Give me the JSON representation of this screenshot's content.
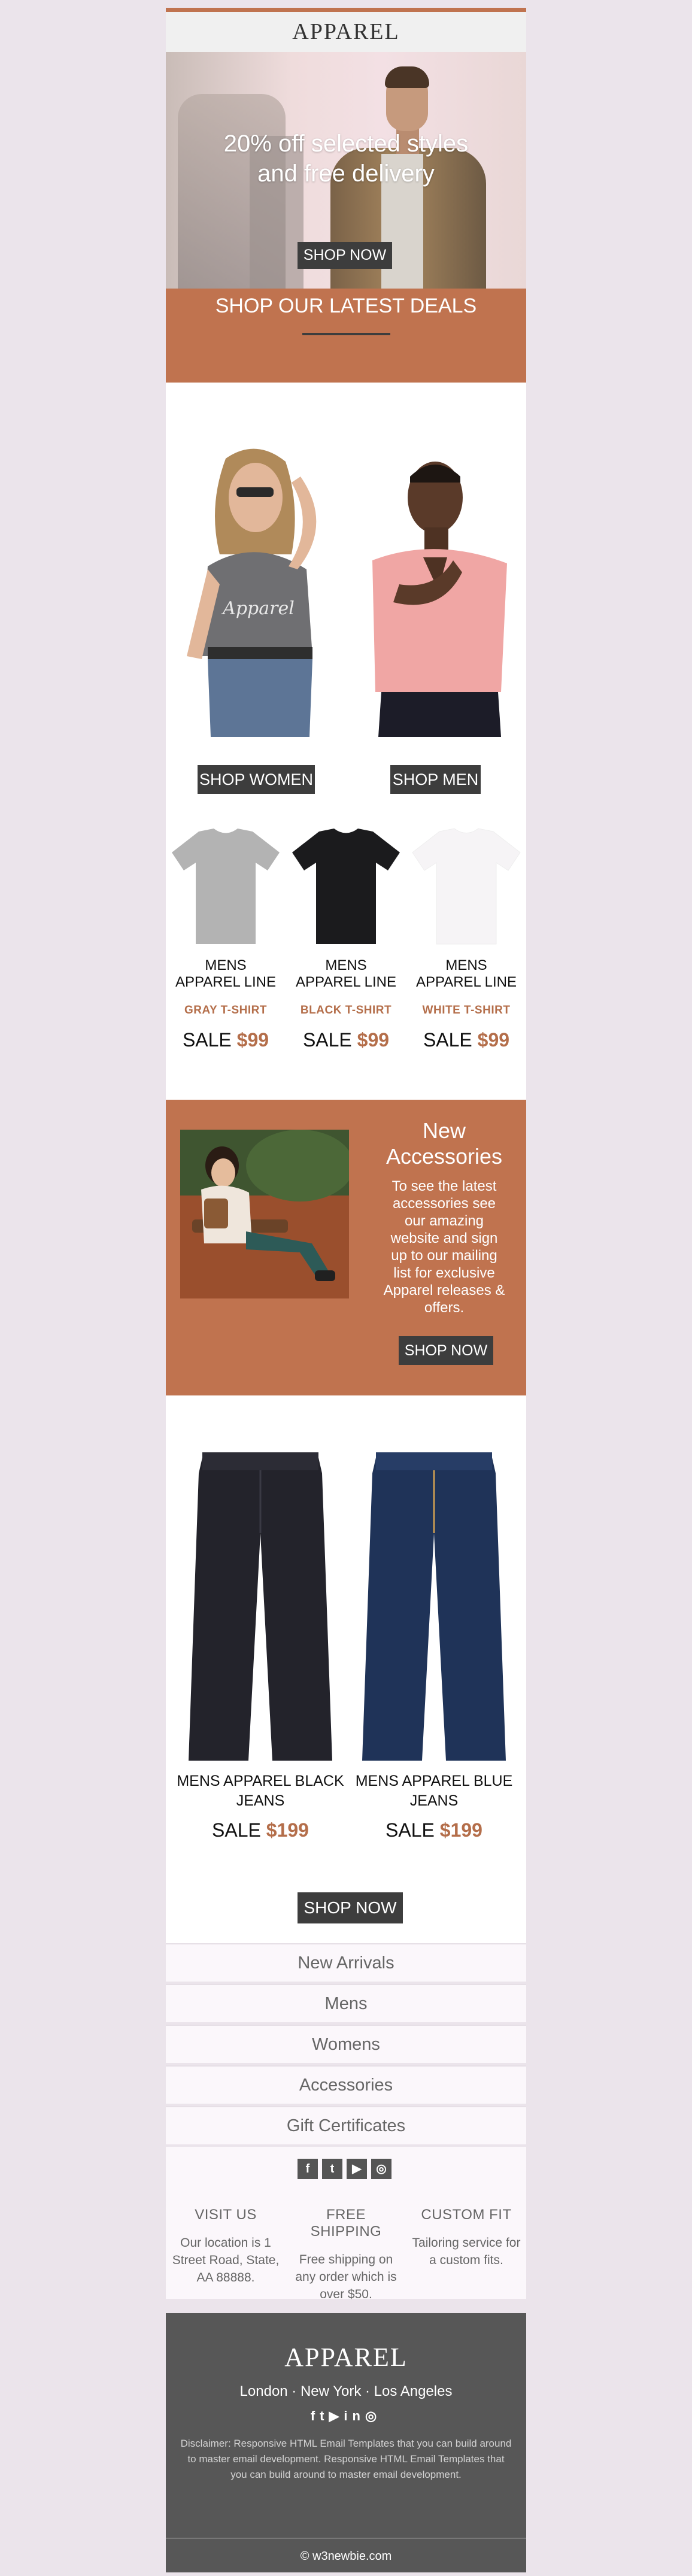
{
  "brand": "APPAREL",
  "hero": {
    "title_line1": "20% off selected styles",
    "title_line2": "and free delivery",
    "button": "SHOP NOW"
  },
  "deals": {
    "title": "SHOP OUR LATEST DEALS"
  },
  "models": {
    "women_button": "SHOP WOMEN",
    "men_button": "SHOP MEN"
  },
  "tshirts": [
    {
      "line1": "MENS",
      "line2": "APPAREL LINE",
      "color_label": "GRAY T-SHIRT",
      "sale_label": "SALE",
      "price": "$99",
      "color": "#b3b3b3"
    },
    {
      "line1": "MENS",
      "line2": "APPAREL LINE",
      "color_label": "BLACK T-SHIRT",
      "sale_label": "SALE",
      "price": "$99",
      "color": "#1b1b1d"
    },
    {
      "line1": "MENS",
      "line2": "APPAREL LINE",
      "color_label": "WHITE T-SHIRT",
      "sale_label": "SALE",
      "price": "$99",
      "color": "#f6f4f6"
    }
  ],
  "accessories": {
    "title": "New Accessories",
    "text": "To see the latest accessories see our amazing website and sign up to our mailing list for exclusive Apparel releases & offers.",
    "button": "SHOP NOW"
  },
  "jeans": [
    {
      "name": "MENS APPAREL BLACK JEANS",
      "sale_label": "SALE",
      "price": "$199",
      "color": "#23232b"
    },
    {
      "name": "MENS APPAREL BLUE JEANS",
      "sale_label": "SALE",
      "price": "$199",
      "color": "#1f3358"
    }
  ],
  "jeans_button": "SHOP NOW",
  "nav": [
    "New Arrivals",
    "Mens",
    "Womens",
    "Accessories",
    "Gift Certificates"
  ],
  "info": [
    {
      "title": "VISIT US",
      "text": "Our location is 1 Street Road, State, AA 88888."
    },
    {
      "title": "FREE SHIPPING",
      "text": "Free shipping on any order which is over $50."
    },
    {
      "title": "CUSTOM FIT",
      "text": "Tailoring service for a custom fits."
    }
  ],
  "social_icons": [
    "facebook-icon",
    "twitter-icon",
    "youtube-icon",
    "instagram-icon"
  ],
  "footer": {
    "brand": "APPAREL",
    "cities": "London · New York · Los Angeles",
    "disclaimer": "Disclaimer: Responsive HTML Email Templates that you can build around to master email development. Responsive HTML Email Templates that you can build around to master email development.",
    "copyright": "© w3newbie.com"
  },
  "colors": {
    "accent": "#c0734f",
    "button": "#3d3d3d",
    "price": "#b46e4a",
    "footer": "#575757"
  }
}
